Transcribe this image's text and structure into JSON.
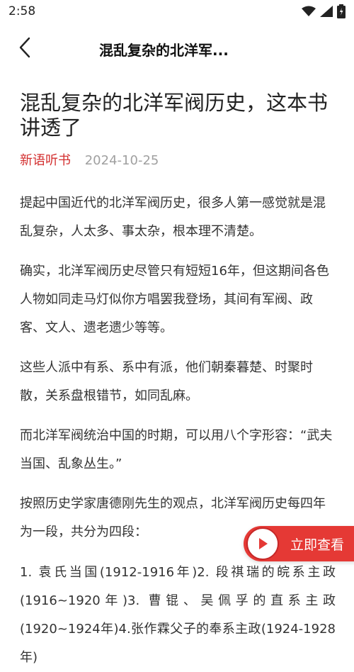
{
  "status_bar": {
    "time": "2:58"
  },
  "nav": {
    "title": "混乱复杂的北洋军..."
  },
  "article": {
    "headline": "混乱复杂的北洋军阀历史，这本书讲透了",
    "source": "新语听书",
    "date": "2024-10-25",
    "paragraphs": [
      "提起中国近代的北洋军阀历史，很多人第一感觉就是混乱复杂，人太多、事太杂，根本理不清楚。",
      "确实，北洋军阀历史尽管只有短短16年，但这期间各色人物如同走马灯似你方唱罢我登场，其间有军阀、政客、文人、遗老遗少等等。",
      "这些人派中有系、系中有派，他们朝秦暮楚、时聚时散，关系盘根错节，如同乱麻。",
      "而北洋军阀统治中国的时期，可以用八个字形容：“武夫当国、乱象丛生。”",
      "按照历史学家唐德刚先生的观点，北洋军阀历史每四年为一段，共分为四段：",
      "1. 袁氏当国(1912-1916年)2. 段祺瑞的皖系主政(1916~1920年)3. 曹锟、吴佩孚的直系主政(1920~1924年)4.张作霖父子的奉系主政(1924-1928年)"
    ]
  },
  "cta": {
    "label": "立即查看"
  },
  "icons": {
    "back": "chevron-left-icon",
    "play": "play-icon",
    "wifi": "wifi-icon",
    "signal": "signal-icon",
    "battery": "battery-icon"
  },
  "colors": {
    "accent": "#e53935",
    "source": "#d32f2f",
    "meta": "#a0a0a0"
  }
}
